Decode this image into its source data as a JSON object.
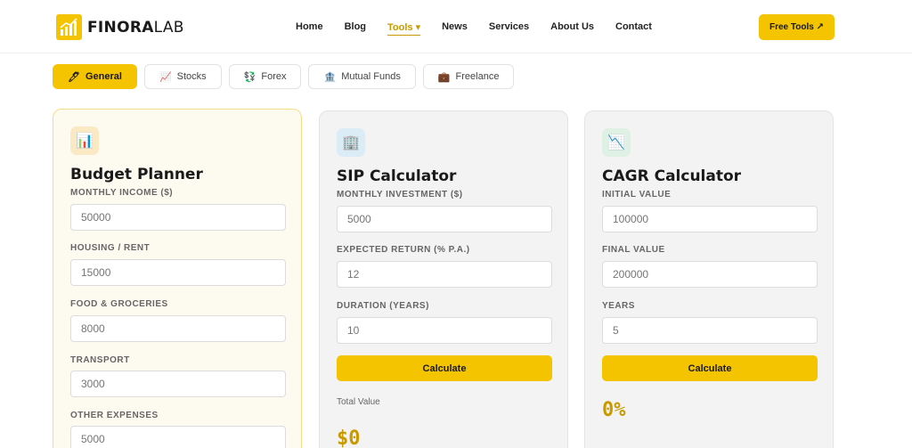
{
  "brand": {
    "name_bold": "FINORA",
    "name_light": "LAB"
  },
  "nav": {
    "items": [
      {
        "label": "Home",
        "active": false
      },
      {
        "label": "Blog",
        "active": false
      },
      {
        "label": "Tools ▾",
        "active": true
      },
      {
        "label": "News",
        "active": false
      },
      {
        "label": "Services",
        "active": false
      },
      {
        "label": "About Us",
        "active": false
      },
      {
        "label": "Contact",
        "active": false
      }
    ],
    "cta_label": "Free Tools ↗"
  },
  "tabs": [
    {
      "icon": "🖊",
      "label": "General",
      "active": true
    },
    {
      "icon": "📈",
      "label": "Stocks",
      "active": false
    },
    {
      "icon": "💱",
      "label": "Forex",
      "active": false
    },
    {
      "icon": "🏦",
      "label": "Mutual Funds",
      "active": false
    },
    {
      "icon": "💼",
      "label": "Freelance",
      "active": false
    }
  ],
  "cards": {
    "budget": {
      "icon": "📊",
      "title": "Budget Planner",
      "fields": [
        {
          "label": "MONTHLY INCOME ($)",
          "placeholder": "50000"
        },
        {
          "label": "HOUSING / RENT",
          "placeholder": "15000"
        },
        {
          "label": "FOOD & GROCERIES",
          "placeholder": "8000"
        },
        {
          "label": "TRANSPORT",
          "placeholder": "3000"
        },
        {
          "label": "OTHER EXPENSES",
          "placeholder": "5000"
        }
      ]
    },
    "sip": {
      "icon": "🏢",
      "title": "SIP Calculator",
      "fields": [
        {
          "label": "MONTHLY INVESTMENT ($)",
          "placeholder": "5000"
        },
        {
          "label": "EXPECTED RETURN (% P.A.)",
          "placeholder": "12"
        },
        {
          "label": "DURATION (YEARS)",
          "placeholder": "10"
        }
      ],
      "button_label": "Calculate",
      "result_label": "Total Value",
      "result_value": "$0"
    },
    "cagr": {
      "icon": "📉",
      "title": "CAGR Calculator",
      "fields": [
        {
          "label": "INITIAL VALUE",
          "placeholder": "100000"
        },
        {
          "label": "FINAL VALUE",
          "placeholder": "200000"
        },
        {
          "label": "YEARS",
          "placeholder": "5"
        }
      ],
      "button_label": "Calculate",
      "result_value": "0%"
    }
  },
  "colors": {
    "accent": "#f5c400",
    "accent_text": "#c99a00"
  }
}
